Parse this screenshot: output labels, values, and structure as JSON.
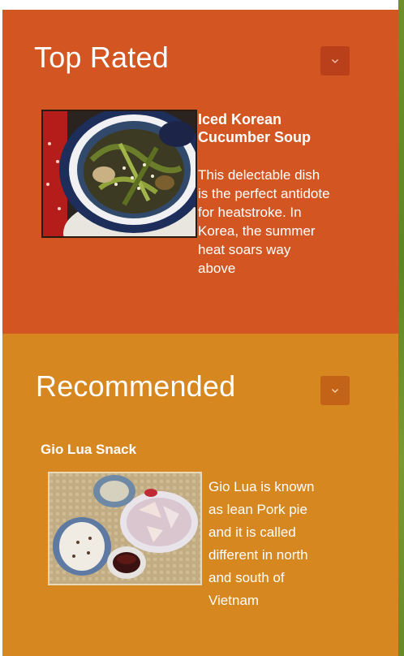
{
  "top_rated": {
    "title": "Top Rated",
    "toggle_icon": "chevron-down-icon",
    "article": {
      "title": "Iced Korean Cucumber Soup",
      "snippet": "This delectable dish is the perfect antidote for heatstroke. In Korea, the summer heat soars way above",
      "image_alt": "Iced Korean Cucumber Soup photo"
    }
  },
  "recommended": {
    "title": "Recommended",
    "toggle_icon": "chevron-down-icon",
    "article": {
      "title": "Gio Lua Snack",
      "snippet": "Gio Lua is known as lean Pork pie and it is called different in north and south of Vietnam",
      "image_alt": "Gio Lua Snack photo"
    }
  },
  "colors": {
    "top_panel": "#d35622",
    "recommended_panel": "#d7871f",
    "right_strip": "#6f8f2a"
  }
}
